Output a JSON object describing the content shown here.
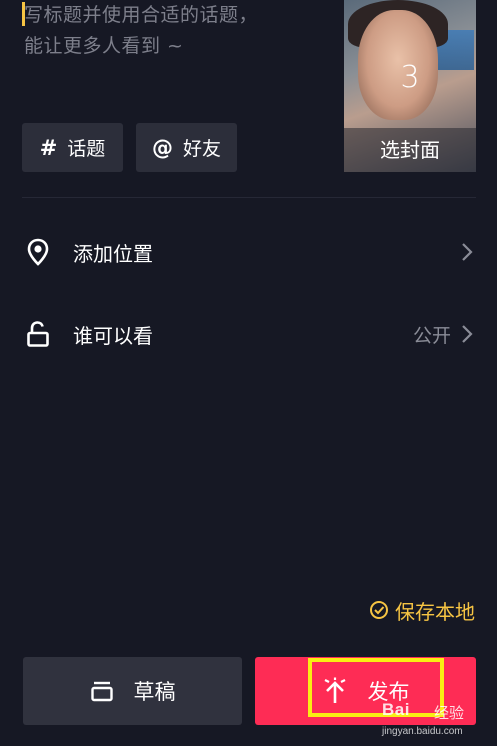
{
  "caption": {
    "placeholder_line1": "写标题并使用合适的话题，",
    "placeholder_line2": "能让更多人看到 ~"
  },
  "cover": {
    "count": "3",
    "label": "选封面"
  },
  "chips": {
    "topic_icon": "#",
    "topic_label": "话题",
    "friend_icon": "@",
    "friend_label": "好友"
  },
  "options": {
    "location_label": "添加位置",
    "visibility_label": "谁可以看",
    "visibility_value": "公开"
  },
  "save_local": {
    "label": "保存本地"
  },
  "actions": {
    "draft_label": "草稿",
    "publish_label": "发布"
  },
  "watermark": {
    "brand": "Bai",
    "brand_cn": "经验",
    "url": "jingyan.baidu.com"
  },
  "icons": {
    "location": "location-pin-icon",
    "visibility": "unlock-icon",
    "chevron": "chevron-right-icon",
    "save": "check-circle-icon",
    "draft": "draft-box-icon",
    "publish": "upload-arrow-icon"
  },
  "colors": {
    "background": "#161824",
    "accent_yellow": "#f6c443",
    "publish_red": "#fe2c55",
    "chip_bg": "#2c2e3a",
    "highlight": "#f9ee13"
  }
}
